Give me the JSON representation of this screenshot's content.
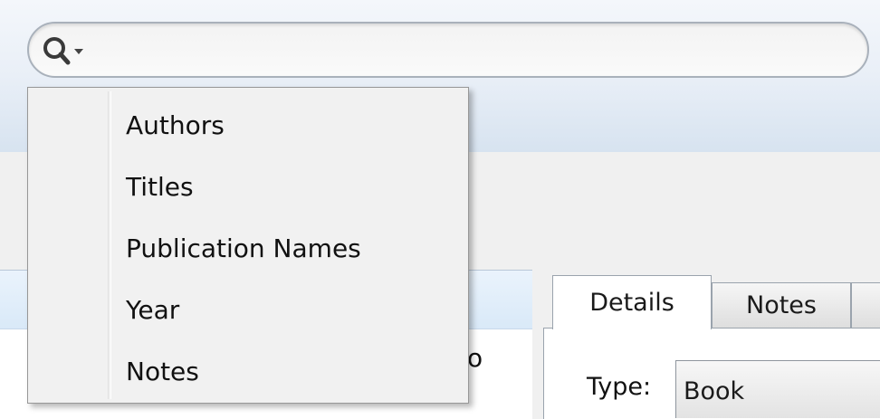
{
  "search": {
    "value": "",
    "placeholder": "",
    "icon": "search-icon",
    "dropdown_icon": "chevron-down-icon"
  },
  "search_menu": {
    "items": [
      {
        "label": "Authors"
      },
      {
        "label": "Titles"
      },
      {
        "label": "Publication Names"
      },
      {
        "label": "Year"
      },
      {
        "label": "Notes"
      }
    ]
  },
  "list": {
    "visible_cell": "o"
  },
  "details": {
    "tabs": [
      {
        "label": "Details",
        "selected": true
      },
      {
        "label": "Notes",
        "selected": false
      }
    ],
    "type_label": "Type:",
    "type_value": "Book"
  },
  "colors": {
    "toolbar_gradient_bottom": "#d7e3f0",
    "menu_background": "#f1f1f1",
    "list_header": "#d9e9f8"
  }
}
